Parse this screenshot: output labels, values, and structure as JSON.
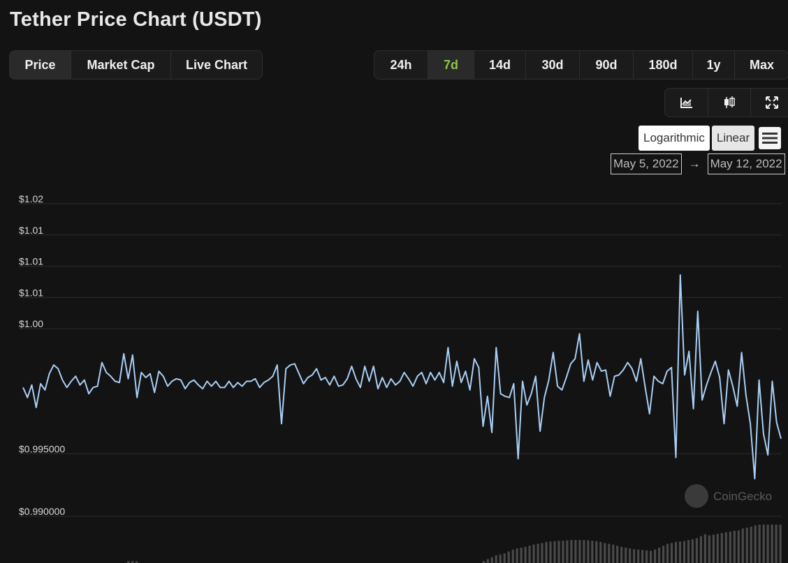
{
  "page": {
    "title": "Tether Price Chart (USDT)",
    "metric_tabs": [
      {
        "label": "Price",
        "active": true
      },
      {
        "label": "Market Cap",
        "active": false
      },
      {
        "label": "Live Chart",
        "active": false
      }
    ],
    "range_tabs": [
      {
        "label": "24h",
        "active": false
      },
      {
        "label": "7d",
        "active": true
      },
      {
        "label": "14d",
        "active": false
      },
      {
        "label": "30d",
        "active": false
      },
      {
        "label": "90d",
        "active": false
      },
      {
        "label": "180d",
        "active": false
      },
      {
        "label": "1y",
        "active": false
      },
      {
        "label": "Max",
        "active": false
      }
    ],
    "tools": [
      "line-chart-icon",
      "candlestick-icon",
      "fullscreen-icon"
    ],
    "scale": {
      "logarithmic": "Logarithmic",
      "linear": "Linear",
      "selected": "Linear"
    },
    "date_range": {
      "from": "May 5, 2022",
      "arrow": "→",
      "to": "May 12, 2022"
    },
    "watermark": "CoinGecko",
    "colors": {
      "line": "#a9cff5",
      "accent_green": "#8dc647",
      "background": "#131313",
      "grid": "#2c2c2c",
      "volume": "#4a4a4a"
    }
  },
  "chart_data": {
    "type": "line",
    "title": "",
    "xlabel": "",
    "ylabel": "",
    "x_range": [
      "May 5, 2022",
      "May 12, 2022"
    ],
    "ylim": [
      0.99,
      1.015
    ],
    "y_ticks": [
      1.015,
      1.0125,
      1.01,
      1.0075,
      1.005,
      0.995,
      0.99
    ],
    "y_tick_labels": [
      "$1.02",
      "$1.01",
      "$1.01",
      "$1.01",
      "$1.00",
      "$0.995000",
      "$0.990000"
    ],
    "grid": true,
    "series": [
      {
        "values": [
          1.0003,
          0.9995,
          1.0005,
          0.9987,
          1.0006,
          1.0001,
          1.0014,
          1.0021,
          1.0018,
          1.0009,
          1.0003,
          1.0008,
          1.0012,
          1.0005,
          1.0009,
          0.9998,
          1.0003,
          1.0004,
          1.0023,
          1.0015,
          1.0012,
          1.0008,
          1.0007,
          1.003,
          1.001,
          1.0029,
          0.9995,
          1.0015,
          1.0011,
          1.0014,
          0.9999,
          1.0016,
          1.0012,
          1.0004,
          1.0008,
          1.001,
          1.0009,
          1.0002,
          1.0007,
          1.0009,
          1.0005,
          1.0002,
          1.0008,
          1.0004,
          1.0008,
          1.0003,
          1.0003,
          1.0008,
          1.0003,
          1.0007,
          1.0004,
          1.0008,
          1.0008,
          1.001,
          1.0003,
          1.0007,
          1.0009,
          1.0012,
          1.0021,
          0.9974,
          1.0018,
          1.0021,
          1.0022,
          1.0014,
          1.0006,
          1.0011,
          1.0013,
          1.0018,
          1.0009,
          1.0011,
          1.0005,
          1.0012,
          1.0004,
          1.0005,
          1.001,
          1.002,
          1.001,
          1.0003,
          1.002,
          1.0008,
          1.002,
          1.0002,
          1.0011,
          1.0003,
          1.001,
          1.0005,
          1.0008,
          1.0015,
          1.001,
          1.0004,
          1.0012,
          1.0015,
          1.0006,
          1.0015,
          1.0009,
          1.0015,
          1.0007,
          1.0035,
          1.0004,
          1.0024,
          1.0007,
          1.0016,
          1.0001,
          1.0026,
          1.0019,
          0.9972,
          0.9996,
          0.9967,
          1.0035,
          0.9998,
          0.9996,
          0.9995,
          1.0006,
          0.9946,
          1.0008,
          0.9989,
          0.9998,
          1.0012,
          0.9968,
          0.9995,
          1.0009,
          1.0031,
          1.0004,
          1.0001,
          1.0011,
          1.0022,
          1.0026,
          1.0046,
          1.0008,
          1.0025,
          1.0009,
          1.0023,
          1.0016,
          1.0017,
          0.9996,
          1.0012,
          1.0013,
          1.0017,
          1.0023,
          1.0018,
          1.0008,
          1.0026,
          1.0003,
          0.9982,
          1.0012,
          1.0008,
          1.0006,
          1.0016,
          1.0019,
          0.9947,
          1.0093,
          1.0013,
          1.0032,
          0.9986,
          1.0064,
          0.9993,
          1.0005,
          1.0015,
          1.0024,
          1.0011,
          0.9974,
          1.0017,
          1.0004,
          0.9988,
          1.0031,
          0.9997,
          0.9974,
          0.993,
          1.0009,
          0.9966,
          0.9949,
          1.0008,
          0.9975,
          0.9962
        ]
      }
    ],
    "volume": [
      0,
      0,
      0,
      0,
      0,
      0,
      0,
      0,
      0,
      0,
      0,
      0,
      0,
      0,
      0,
      0,
      0,
      0,
      0,
      0,
      0,
      0,
      0,
      0,
      0,
      0,
      0.05,
      0.05,
      0.05,
      0,
      0,
      0,
      0,
      0,
      0,
      0,
      0,
      0,
      0,
      0,
      0,
      0,
      0,
      0,
      0,
      0,
      0,
      0,
      0,
      0,
      0,
      0,
      0,
      0,
      0,
      0,
      0,
      0,
      0,
      0,
      0,
      0,
      0,
      0,
      0,
      0,
      0,
      0,
      0,
      0,
      0,
      0,
      0,
      0,
      0,
      0,
      0,
      0,
      0,
      0,
      0,
      0,
      0,
      0,
      0,
      0,
      0,
      0,
      0,
      0,
      0,
      0,
      0,
      0,
      0,
      0,
      0,
      0,
      0,
      0,
      0,
      0,
      0,
      0,
      0,
      0,
      0,
      0,
      0,
      0,
      0,
      0.05,
      0.1,
      0.15,
      0.2,
      0.22,
      0.25,
      0.3,
      0.35,
      0.38,
      0.4,
      0.42,
      0.45,
      0.48,
      0.5,
      0.52,
      0.55,
      0.56,
      0.57,
      0.58,
      0.58,
      0.59,
      0.6,
      0.6,
      0.6,
      0.6,
      0.59,
      0.58,
      0.57,
      0.55,
      0.52,
      0.5,
      0.48,
      0.45,
      0.42,
      0.4,
      0.38,
      0.36,
      0.35,
      0.34,
      0.33,
      0.32,
      0.35,
      0.4,
      0.45,
      0.5,
      0.52,
      0.55,
      0.56,
      0.57,
      0.6,
      0.62,
      0.65,
      0.7,
      0.75,
      0.72,
      0.74,
      0.76,
      0.78,
      0.8,
      0.82,
      0.84,
      0.85,
      0.9,
      0.92,
      0.95,
      0.98,
      1.0,
      1.0,
      1.0,
      1.0,
      1.0,
      1.0
    ]
  }
}
